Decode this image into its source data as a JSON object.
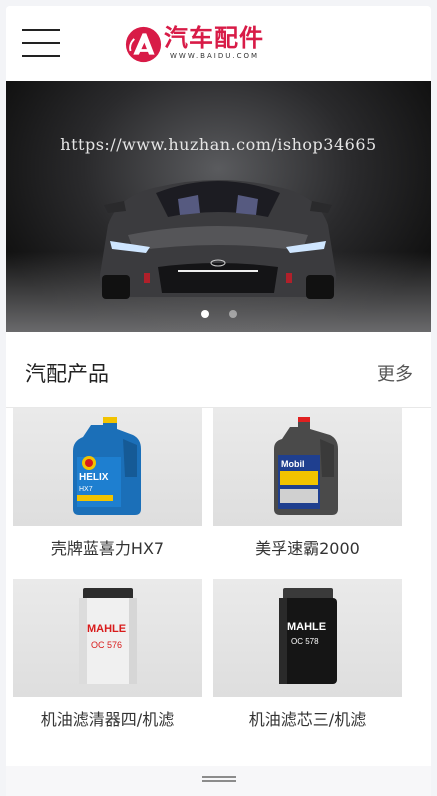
{
  "header": {
    "menu_icon": "hamburger-menu-icon",
    "logo": {
      "title": "汽车配件",
      "subtitle": "WWW.BAIDU.COM",
      "mark_letter": "A",
      "brand_color": "#d81b47"
    }
  },
  "banner": {
    "watermark": "https://www.huzhan.com/ishop34665",
    "slide_count": 2,
    "active_slide": 1
  },
  "section": {
    "title": "汽配产品",
    "more_label": "更多"
  },
  "products": [
    {
      "name": "壳牌蓝喜力HX7",
      "image": "shell-helix-oil-bottle",
      "bottle_label": "Shell HELIX HX7"
    },
    {
      "name": "美孚速霸2000",
      "image": "mobil-oil-bottle",
      "bottle_label": "Mobil 美孚速霸"
    },
    {
      "name": "机油滤清器四/机滤",
      "image": "white-oil-filter",
      "filter_label": "MAHLE OC 576"
    },
    {
      "name": "机油滤芯三/机滤",
      "image": "black-oil-filter",
      "filter_label": "MAHLE OC 578"
    }
  ],
  "bottom_bar": {
    "handle_icon": "drag-handle-icon"
  }
}
